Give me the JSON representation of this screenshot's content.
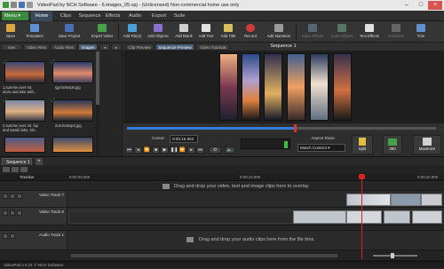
{
  "app": {
    "title": "VideoPad by NCH Software - 6.images_05.vpj - (Unlicensed) Non-commercial home use only",
    "status": "VideoPad v 8.31 © NCH Software"
  },
  "menu": {
    "menu_button": "Menu",
    "tabs": [
      "Home",
      "Clips",
      "Sequence",
      "Effects",
      "Audio",
      "Export",
      "Suite"
    ]
  },
  "toolbar": {
    "items": [
      "Open",
      "Templates",
      "Save Project",
      "Export Video",
      "Add File(s)",
      "Add Objects",
      "Add Blank",
      "Add Text",
      "Add Title",
      "Record",
      "Add Narration",
      "Video Effects",
      "Audio Effects",
      "Text Effects",
      "Transition",
      "Trim"
    ]
  },
  "bin": {
    "tabs": [
      "rues",
      "Video Files",
      "Audio Files",
      "Images"
    ],
    "items": [
      {
        "caption1": "1.sunrise over mt.",
        "caption2": "uluru and lake with..."
      },
      {
        "caption1": "tgp-betssp5.jpg",
        "caption2": ""
      },
      {
        "caption1": "2.sunrise over mt. fuji",
        "caption2": "and tanuki lake, shi..."
      },
      {
        "caption1": "2us-betssp3.jpg",
        "caption2": ""
      }
    ]
  },
  "preview": {
    "tabs": [
      "Clip Preview",
      "Sequence Preview",
      "Video Tutorials"
    ],
    "sequence_title": "Sequence 1",
    "cursor_label": "Cursor:",
    "cursor_value": "0:00:15.962",
    "aspect_label": "Aspect Ratio:",
    "aspect_value": "Match Content",
    "split_label": "Split",
    "maximize_label": "Maximize",
    "res_label": "360",
    "playback_position": 0.54
  },
  "timeline": {
    "tab": "Sequence 1",
    "ruler_label": "Timeline",
    "ticks": [
      "0:00:00.000",
      "0:00:10.000",
      "0:00:20.000"
    ],
    "video_hint": "Drag and drop your video, text and image clips here to overlay",
    "audio_hint": "Drag and drop your audio clips here from the file bins",
    "tracks": [
      {
        "name": "Video Track 7"
      },
      {
        "name": "Video Track 6"
      },
      {
        "name": "Audio Track 1"
      }
    ]
  },
  "colors": {
    "accent": "#4a5f78",
    "menu_green": "#3c8a3c",
    "playhead": "#e02020",
    "progress": "#2f7fd8"
  }
}
